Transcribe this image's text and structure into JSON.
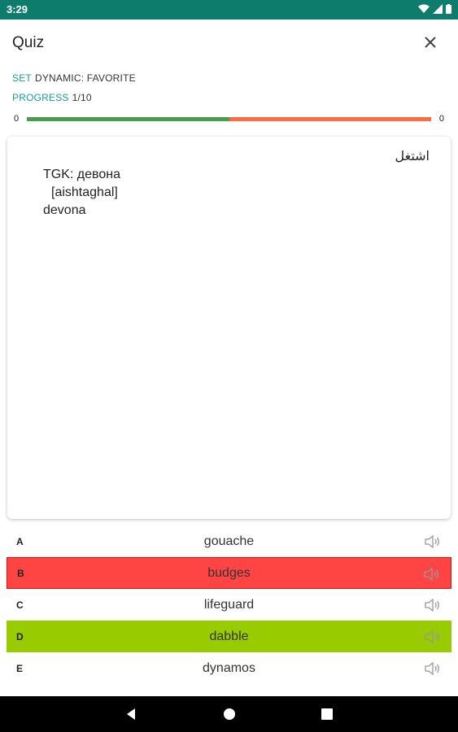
{
  "status": {
    "time": "3:29"
  },
  "header": {
    "title": "Quiz"
  },
  "meta": {
    "set_label": "SET",
    "set_value": "DYNAMIC: FAVORITE",
    "progress_label": "PROGRESS",
    "progress_value": "1/10"
  },
  "progress": {
    "left_count": "0",
    "right_count": "0",
    "correct_fraction": 0.5
  },
  "card": {
    "arabic": "اشتغل",
    "line1": "TGK: девона",
    "line2": "[aishtaghal]",
    "line3": "devona"
  },
  "options": [
    {
      "letter": "A",
      "text": "gouache",
      "state": "normal"
    },
    {
      "letter": "B",
      "text": "budges",
      "state": "wrong"
    },
    {
      "letter": "C",
      "text": "lifeguard",
      "state": "normal"
    },
    {
      "letter": "D",
      "text": "dabble",
      "state": "correct"
    },
    {
      "letter": "E",
      "text": "dynamos",
      "state": "normal"
    }
  ],
  "icons": {
    "close": "close-icon",
    "speaker": "speaker-icon",
    "back": "back-icon",
    "home": "home-icon",
    "recents": "recents-icon"
  },
  "colors": {
    "status_bar": "#0e7c6c",
    "accent": "#17a08a",
    "progress_good": "#43a047",
    "progress_bad": "#ff6b3d",
    "wrong": "#ff4444",
    "correct": "#99cc00"
  }
}
